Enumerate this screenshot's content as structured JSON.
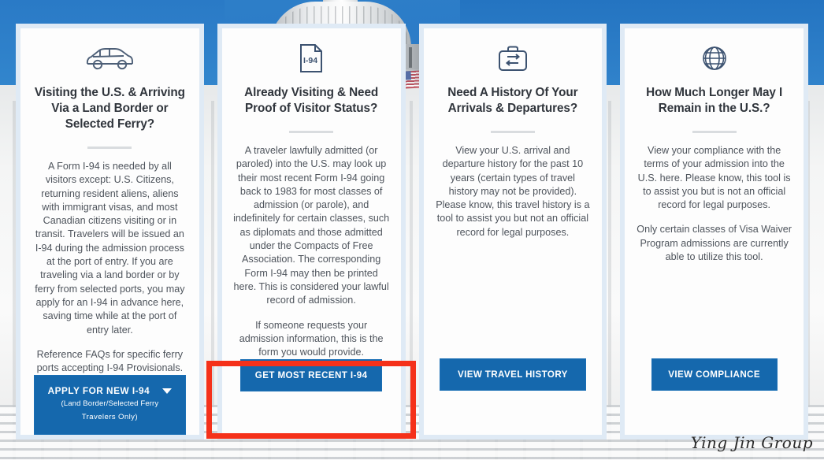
{
  "page": {
    "watermark": "Ying Jin Group",
    "background_description": "U.S. Capitol dome against blue sky"
  },
  "theme": {
    "button_blue": "#1568ad",
    "sky_blue": "#2e7fc9",
    "icon_navy": "#44566f",
    "title_color": "#30353c",
    "body_color": "#4e545c",
    "highlight_red": "#f5311a"
  },
  "cards": [
    {
      "icon": "car-icon",
      "title": "Visiting the U.S. & Arriving Via a Land Border or Selected Ferry?",
      "paragraphs": [
        "A Form I-94 is needed by all visitors except: U.S. Citizens, returning resident aliens, aliens with immigrant visas, and most Canadian citizens visiting or in transit. Travelers will be issued an I-94 during the admission process at the port of entry. If you are traveling via a land border or by ferry from selected ports, you may apply for an I-94 in advance here, saving time while at the port of entry later.",
        "Reference FAQs for specific ferry ports accepting I-94 Provisionals."
      ],
      "button": {
        "label": "APPLY FOR NEW I-94",
        "sub_line_1": "(Land Border/Selected Ferry",
        "sub_line_2": "Travelers Only)",
        "has_caret": true
      }
    },
    {
      "icon": "i94-document-icon",
      "icon_text": "I-94",
      "title": "Already Visiting & Need Proof of Visitor Status?",
      "paragraphs": [
        "A traveler lawfully admitted (or paroled) into the U.S. may look up their most recent Form I-94 going back to 1983 for most classes of admission (or parole), and indefinitely for certain classes, such as diplomats and those admitted under the Compacts of Free Association. The corresponding Form I-94 may then be printed here. This is considered your lawful record of admission.",
        "If someone requests your admission information, this is the form you would provide."
      ],
      "button": {
        "label": "GET MOST RECENT I-94",
        "has_caret": false
      },
      "highlighted": true
    },
    {
      "icon": "briefcase-exchange-icon",
      "title": "Need A History Of Your Arrivals & Departures?",
      "paragraphs": [
        "View your U.S. arrival and departure history for the past 10 years (certain types of travel history may not be provided). Please know, this travel history is a tool to assist you but not an official record for legal purposes."
      ],
      "button": {
        "label": "VIEW TRAVEL HISTORY",
        "has_caret": false
      }
    },
    {
      "icon": "globe-icon",
      "title": "How Much Longer May I Remain in the U.S.?",
      "paragraphs": [
        "View your compliance with the terms of your admission into the U.S. here. Please know, this tool is to assist you but is not an official record for legal purposes.",
        "Only certain classes of Visa Waiver Program admissions are currently able to utilize this tool."
      ],
      "button": {
        "label": "VIEW COMPLIANCE",
        "has_caret": false
      }
    }
  ]
}
